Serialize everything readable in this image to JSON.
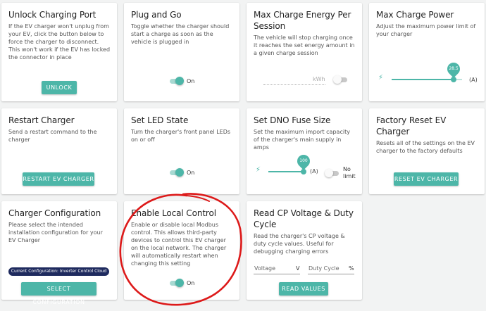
{
  "colors": {
    "accent": "#4db6a8",
    "accent_light": "#a8d9d2",
    "chip_bg": "#1e2a5e",
    "annotation": "#dd1a1a"
  },
  "cards": {
    "unlock": {
      "title": "Unlock Charging Port",
      "desc": "If the EV charger won't unplug from your EV, click the button below to force the charger to disconnect. This won't work if the EV has locked the connector in place",
      "button": "UNLOCK"
    },
    "plug_and_go": {
      "title": "Plug and Go",
      "desc": "Toggle whether the charger should start a charge as soon as the vehicle is plugged in",
      "toggle": {
        "state": true,
        "label": "On"
      }
    },
    "max_charge_energy": {
      "title": "Max Charge Energy Per Session",
      "desc": "The vehicle will stop charging once it reaches the set energy amount in a given charge session",
      "unit": "kWh",
      "toggle": {
        "state": false,
        "label": ""
      }
    },
    "max_charge_power": {
      "title": "Max Charge Power",
      "desc": "Adjust the maximum power limit of your charger",
      "slider": {
        "value": "28.5",
        "fraction": 0.88
      },
      "unit": "(A)",
      "icon": "bolt-icon"
    },
    "restart": {
      "title": "Restart Charger",
      "desc": "Send a restart command to the charger",
      "button": "RESTART EV CHARGER"
    },
    "led": {
      "title": "Set LED State",
      "desc": "Turn the charger's front panel LEDs on or off",
      "toggle": {
        "state": true,
        "label": "On"
      }
    },
    "dno": {
      "title": "Set DNO Fuse Size",
      "desc": "Set the maximum import capacity of the charger's main supply in amps",
      "slider": {
        "value": "100",
        "fraction": 1.0
      },
      "unit": "(A)",
      "icon": "bolt-icon",
      "toggle": {
        "state": false,
        "label": "No limit"
      }
    },
    "factory_reset": {
      "title": "Factory Reset EV Charger",
      "desc": "Resets all of the settings on the EV charger to the factory defaults",
      "button": "RESET EV CHARGER"
    },
    "config": {
      "title": "Charger Configuration",
      "desc": "Please select the intended installation configuration for your EV Charger",
      "chip": "Current Configuration: Inverter Control Cloud",
      "button": "SELECT CONFIGURATION"
    },
    "local_control": {
      "title": "Enable Local Control",
      "desc": "Enable or disable local Modbus control. This allows third-party devices to control this EV charger on the local network. The charger will automatically restart when changing this setting",
      "toggle": {
        "state": true,
        "label": "On"
      }
    },
    "cp_voltage": {
      "title": "Read CP Voltage & Duty Cycle",
      "desc": "Read the charger's CP voltage & duty cycle values. Useful for debugging charging errors",
      "voltage_label": "Voltage",
      "voltage_unit": "V",
      "duty_label": "Duty Cycle",
      "duty_unit": "%",
      "button": "READ VALUES"
    }
  }
}
